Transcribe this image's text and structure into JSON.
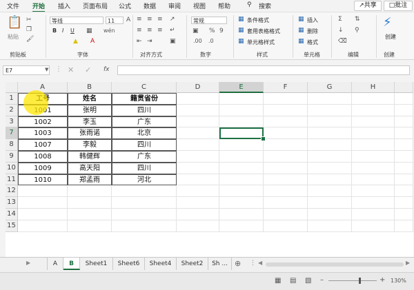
{
  "menu": {
    "items": [
      "文件",
      "开始",
      "插入",
      "页面布局",
      "公式",
      "数据",
      "审阅",
      "视图",
      "帮助",
      "搜索"
    ],
    "active": "开始",
    "share": "共享",
    "comment": "批注"
  },
  "ribbon": {
    "clipboard": {
      "paste": "粘贴",
      "label": "剪贴板"
    },
    "font": {
      "name": "等线",
      "size": "11",
      "label": "字体"
    },
    "alignment": {
      "label": "对齐方式"
    },
    "number": {
      "format": "常规",
      "label": "数字"
    },
    "styles": {
      "conditional": "条件格式",
      "table": "套用表格格式",
      "cell": "单元格样式",
      "label": "样式"
    },
    "cells": {
      "insert": "插入",
      "delete": "删除",
      "format": "格式",
      "label": "单元格"
    },
    "editing": {
      "label": "编辑"
    },
    "create": {
      "button": "创建",
      "label": "创建"
    }
  },
  "formula_bar": {
    "name_box": "E7",
    "fx": "fx",
    "content": ""
  },
  "grid": {
    "columns": [
      "A",
      "B",
      "C",
      "D",
      "E",
      "F",
      "G",
      "H"
    ],
    "selected_column": "E",
    "rows": [
      "1",
      "2",
      "3",
      "7",
      "8",
      "9",
      "10",
      "11",
      "12",
      "13",
      "14",
      "15"
    ],
    "selected_row": "7",
    "table": {
      "header": [
        "工号",
        "姓名",
        "籍贯省份"
      ],
      "rows": [
        [
          "1001",
          "张明",
          "四川"
        ],
        [
          "1002",
          "李玉",
          "广东"
        ],
        [
          "1003",
          "张雨诺",
          "北京"
        ],
        [
          "1007",
          "李毅",
          "四川"
        ],
        [
          "1008",
          "韩健辉",
          "广东"
        ],
        [
          "1009",
          "高天阳",
          "四川"
        ],
        [
          "1010",
          "郑孟雨",
          "河北"
        ]
      ]
    }
  },
  "sheets": {
    "tabs": [
      "A",
      "B",
      "Sheet1",
      "Sheet6",
      "Sheet4",
      "Sheet2",
      "Sh ..."
    ],
    "active": "B"
  },
  "status": {
    "zoom": "130%"
  },
  "colors": {
    "accent": "#1e6e3e",
    "highlight": "#ffe600"
  }
}
